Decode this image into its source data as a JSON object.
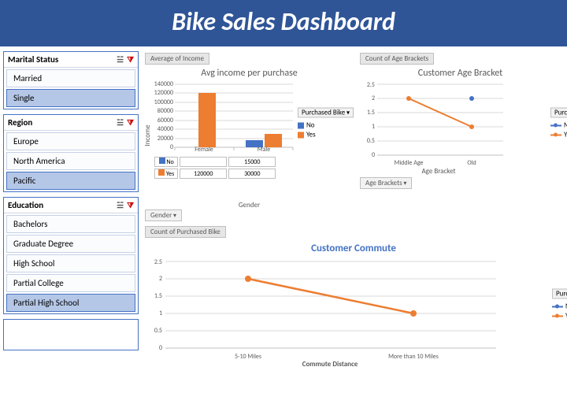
{
  "header": {
    "title": "Bike Sales Dashboard"
  },
  "slicers": [
    {
      "title": "Marital Status",
      "items": [
        {
          "label": "Married",
          "sel": false
        },
        {
          "label": "Single",
          "sel": true
        }
      ]
    },
    {
      "title": "Region",
      "items": [
        {
          "label": "Europe",
          "sel": false
        },
        {
          "label": "North America",
          "sel": false
        },
        {
          "label": "Pacific",
          "sel": true
        }
      ]
    },
    {
      "title": "Education",
      "items": [
        {
          "label": "Bachelors",
          "sel": false
        },
        {
          "label": "Graduate Degree",
          "sel": false
        },
        {
          "label": "High School",
          "sel": false
        },
        {
          "label": "Partial College",
          "sel": false
        },
        {
          "label": "Partial High School",
          "sel": true
        }
      ]
    }
  ],
  "chart1": {
    "tag": "Average of Income",
    "title": "Avg income per purchase",
    "ylabel": "Income",
    "xlabel": "Gender",
    "legend_title": "Purchased Bike",
    "legend": [
      "No",
      "Yes"
    ],
    "drop_below": "Gender",
    "table_rows": [
      "No",
      "Yes"
    ],
    "table_cols": [
      "Female",
      "Male"
    ],
    "table_vals": [
      [
        "",
        "15000"
      ],
      [
        "120000",
        "30000"
      ]
    ]
  },
  "chart2": {
    "tag": "Count of Age Brackets",
    "title": "Customer Age Bracket",
    "xlabel": "Age Bracket",
    "legend_title": "Purchased Bike",
    "legend": [
      "No",
      "Yes"
    ],
    "drop_below": "Age Brackets"
  },
  "chart3": {
    "tag": "Count of Purchased Bike",
    "title": "Customer Commute",
    "xlabel": "Commute Distance",
    "legend_title": "Purchased Bike",
    "legend": [
      "No",
      "Yes"
    ]
  },
  "chart_data": [
    {
      "type": "bar",
      "title": "Avg income per purchase",
      "xlabel": "Gender",
      "ylabel": "Income",
      "ylim": [
        0,
        140000
      ],
      "categories": [
        "Female",
        "Male"
      ],
      "series": [
        {
          "name": "No",
          "values": [
            null,
            15000
          ]
        },
        {
          "name": "Yes",
          "values": [
            120000,
            30000
          ]
        }
      ]
    },
    {
      "type": "line",
      "title": "Customer Age Bracket",
      "xlabel": "Age Bracket",
      "ylabel": "",
      "ylim": [
        0,
        2.5
      ],
      "categories": [
        "Middle Age",
        "Old"
      ],
      "series": [
        {
          "name": "No",
          "values": [
            null,
            2
          ]
        },
        {
          "name": "Yes",
          "values": [
            2,
            1
          ]
        }
      ]
    },
    {
      "type": "line",
      "title": "Customer Commute",
      "xlabel": "Commute Distance",
      "ylabel": "",
      "ylim": [
        0,
        2.5
      ],
      "categories": [
        "5-10 Miles",
        "More than 10 Miles"
      ],
      "series": [
        {
          "name": "No",
          "values": [
            null,
            null
          ]
        },
        {
          "name": "Yes",
          "values": [
            2,
            1
          ]
        }
      ]
    }
  ]
}
